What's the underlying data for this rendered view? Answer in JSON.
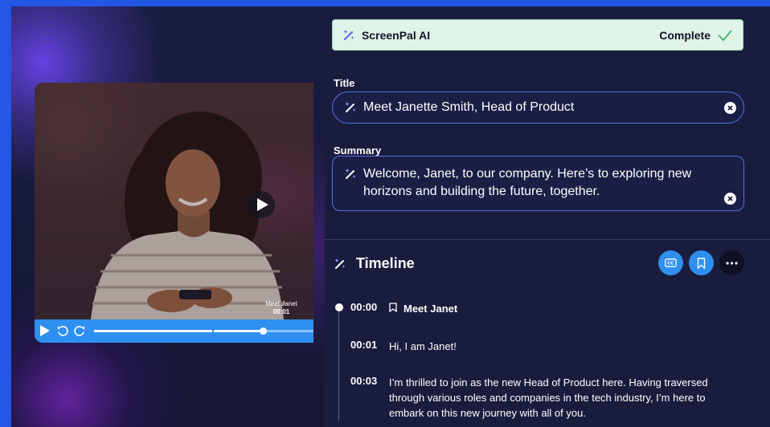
{
  "ai_banner": {
    "name": "ScreenPal AI",
    "status": "Complete"
  },
  "title_field": {
    "label": "Title",
    "value": "Meet Janette Smith, Head of Product"
  },
  "summary_field": {
    "label": "Summary",
    "value": "Welcome, Janet, to our company. Here’s to exploring new horizons and building the future, together."
  },
  "video": {
    "marker_name": "Meet Janet",
    "marker_time": "00:01",
    "progress": 0.77,
    "segment_break": 0.54
  },
  "timeline": {
    "heading": "Timeline",
    "entries": [
      {
        "time": "00:00",
        "text": "Meet Janet",
        "bookmark": true
      },
      {
        "time": "00:01",
        "text": "Hi, I am Janet!"
      },
      {
        "time": "00:03",
        "text": "I’m thrilled to join as the new Head of Product here. Having traversed through various roles and companies in the tech industry, I’m here to embark on this new journey with all of you."
      }
    ]
  },
  "colors": {
    "accent": "#2e8ff0",
    "banner_bg": "#dff3e7",
    "success": "#3bb56a",
    "panel_bg": "#1a1c3d",
    "field_border": "#5670ee"
  },
  "icons": [
    "magic-wand-icon",
    "checkmark-icon",
    "clear-icon",
    "play-icon",
    "rewind-icon",
    "forward-icon",
    "captions-icon",
    "bookmark-icon",
    "more-icon"
  ]
}
